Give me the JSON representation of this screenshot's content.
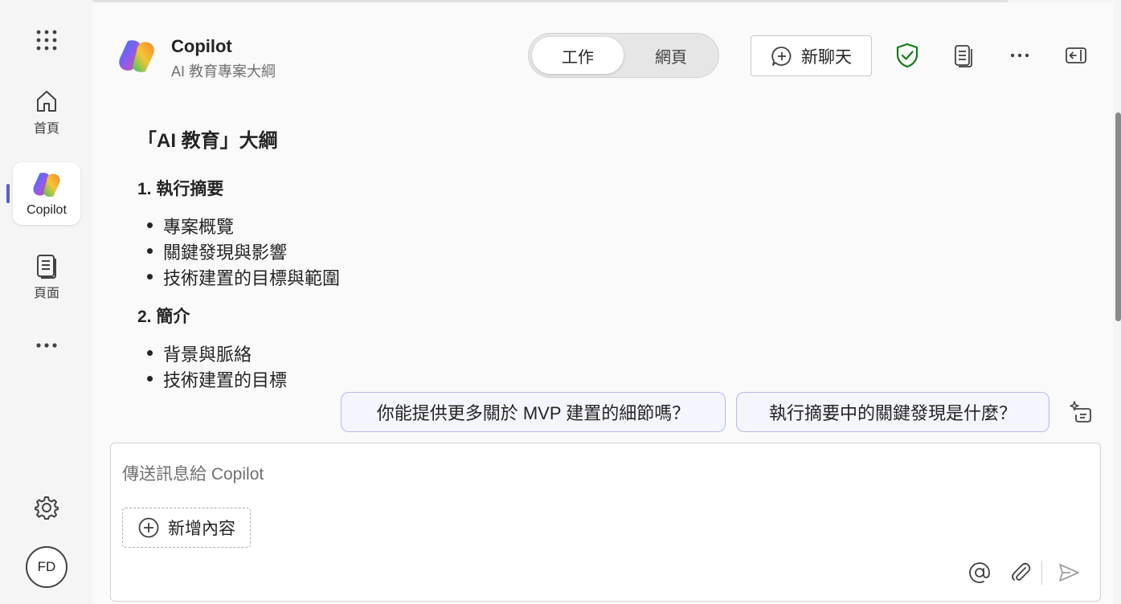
{
  "rail": {
    "home_label": "首頁",
    "copilot_label": "Copilot",
    "pages_label": "頁面",
    "avatar_initials": "FD"
  },
  "header": {
    "title": "Copilot",
    "subtitle": "AI 教育專案大綱",
    "toggle": {
      "work": "工作",
      "web": "網頁",
      "selected": "工作"
    },
    "new_chat_label": "新聊天"
  },
  "outline": {
    "title": "「AI 教育」大綱",
    "sections": [
      {
        "heading": "1. 執行摘要",
        "items": [
          "專案概覽",
          "關鍵發現與影響",
          "技術建置的目標與範圍"
        ]
      },
      {
        "heading": "2. 簡介",
        "items": [
          "背景與脈絡",
          "技術建置的目標"
        ]
      }
    ]
  },
  "suggestions": [
    "你能提供更多關於 MVP 建置的細節嗎？",
    "執行摘要中的關鍵發現是什麼？"
  ],
  "composer": {
    "placeholder": "傳送訊息給 Copilot",
    "add_content_label": "新增內容"
  },
  "colors": {
    "accent": "#5b5fc7",
    "shield": "#107c10",
    "suggestion_border": "#b4b8f0"
  }
}
